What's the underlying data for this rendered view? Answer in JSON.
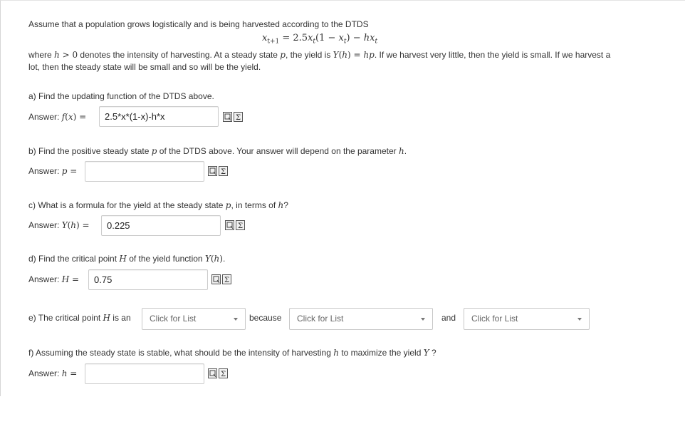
{
  "intro": {
    "line1": "Assume that a population grows logistically and is being harvested according to the DTDS",
    "equation_left": "x",
    "equation_sub": "t+1",
    "equation_mid": " = 2.5x",
    "equation_sub2": "t",
    "equation_rest1": "(1 − x",
    "equation_sub3": "t",
    "equation_rest2": ") − hx",
    "equation_sub4": "t",
    "line2": "where h > 0 denotes the intensity of harvesting. At a steady state p, the yield is Y(h) = hp. If we harvest very little, then the yield is small. If we harvest a",
    "line3": "lot, then the steady state will be small and so will be the yield."
  },
  "parts": {
    "a": {
      "question": "a) Find the updating function of the DTDS above.",
      "answer_label": "Answer: f(x) =",
      "value": "2.5*x*(1-x)-h*x"
    },
    "b": {
      "question": "b) Find the positive steady state p of the DTDS above. Your answer will depend on the parameter h.",
      "answer_label": "Answer: p =",
      "value": ""
    },
    "c": {
      "question": "c) What is a formula for the yield at the steady state p, in terms of h?",
      "answer_label": "Answer: Y(h) =",
      "value": "0.225"
    },
    "d": {
      "question": "d) Find the critical point H of the yield function Y(h).",
      "answer_label": "Answer: H =",
      "value": "0.75"
    },
    "e": {
      "prefix": "e) The critical point H is an",
      "because": "because",
      "and": "and",
      "select1": "Click for List",
      "select2": "Click for List",
      "select3": "Click for List"
    },
    "f": {
      "question": "f) Assuming the steady state is stable, what should be the intensity of harvesting h to maximize the yield Y ?",
      "answer_label": "Answer: h =",
      "value": ""
    }
  },
  "icons": [
    "preview-answer-icon",
    "equation-editor-icon"
  ]
}
